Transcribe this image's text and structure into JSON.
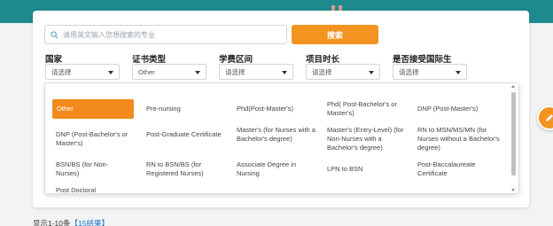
{
  "search": {
    "placeholder": "请用英文输入您想搜索的专业",
    "button_label": "搜索"
  },
  "filters": [
    {
      "label": "国家",
      "value": "请选择"
    },
    {
      "label": "证书类型",
      "value": "Other"
    },
    {
      "label": "学费区间",
      "value": "请选择"
    },
    {
      "label": "项目时长",
      "value": "请选择"
    },
    {
      "label": "是否接受国际生",
      "value": "请选择"
    }
  ],
  "dropdown": {
    "selected": "Other",
    "options": [
      "Other",
      "Pre-nursing",
      "Phd(Post-Master's)",
      "Phd( Post-Bachelor's or Master's)",
      "DNP (Post-Master's)",
      "DNP (Post-Bachelor's or Master's)",
      "Post-Graduate Certificate",
      "Master's (for Nurses with a Bachelor's degree)",
      "Master's (Entry-Level) (for Non-Nurses with a Bachelor's degree)",
      "RN to MSN/MS/MN (for Nurses without a Bachelor's degree)",
      "BSN/BS (for Non-Nurses)",
      "RN to BSN/BS (for Registered Nurses)",
      "Associate Degree in Nursing",
      "LPN to BSN",
      "Post-Baccalaureate Certificate",
      "Post Doctoral"
    ]
  },
  "footer": {
    "prefix": "显示1-10条",
    "count_link": "【15结果】"
  },
  "colors": {
    "accent": "#f39420",
    "header_band": "#1f8a8d",
    "link": "#1a73c7"
  },
  "icons": {
    "search": "search-icon",
    "float": "edit-icon"
  }
}
